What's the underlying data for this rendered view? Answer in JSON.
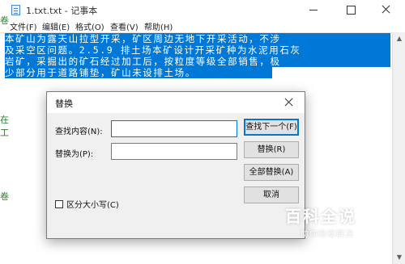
{
  "window": {
    "title": "1.txt.txt - 记事本"
  },
  "menu": {
    "items": [
      "文件(F)",
      "编辑(E)",
      "格式(O)",
      "查看(V)",
      "帮助(H)"
    ]
  },
  "editor": {
    "lines": [
      "本矿山为露天山拉型开采，矿区周边无地下开采活动，不涉",
      "及采空区问题。2.5.9 排土场本矿设计开采矿种为水泥用石灰",
      "岩矿，采掘出的矿石经过加工后，按粒度等级全部销售，极",
      "少部分用于道路铺垫，矿山未设排土场。"
    ],
    "selection_color": "#0078d7"
  },
  "background_glyphs": [
    "卷",
    "在",
    "工",
    "卷"
  ],
  "dialog": {
    "title": "替换",
    "find_label": "查找内容(N):",
    "find_value": "",
    "replace_label": "替换为(P):",
    "replace_value": "",
    "buttons": {
      "find_next": "查找下一个(F)",
      "replace": "替换(R)",
      "replace_all": "全部替换(A)",
      "cancel": "取消"
    },
    "match_case": {
      "label": "区分大小写(C)",
      "checked": false
    }
  },
  "watermark": {
    "main": "百科全说",
    "sub": "助你轻松解决"
  }
}
